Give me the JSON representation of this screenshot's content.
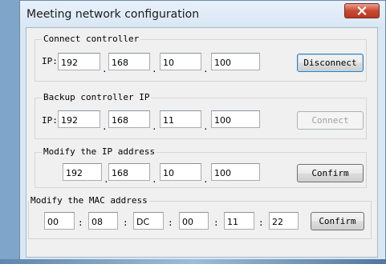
{
  "window": {
    "title": "Meeting network configuration",
    "close_icon": "close-icon"
  },
  "connect": {
    "legend": "Connect controller",
    "ip_label": "IP:",
    "ip": [
      "192",
      "168",
      "10",
      "100"
    ],
    "button": "Disconnect"
  },
  "backup": {
    "legend": "Backup controller IP",
    "ip_label": "IP:",
    "ip": [
      "192",
      "168",
      "11",
      "100"
    ],
    "button": "Connect"
  },
  "modify_ip": {
    "legend": "Modify the IP address",
    "ip": [
      "192",
      "168",
      "10",
      "100"
    ],
    "button": "Confirm"
  },
  "modify_mac": {
    "legend": "Modify the MAC address",
    "mac": [
      "00",
      "08",
      "DC",
      "00",
      "11",
      "22"
    ],
    "button": "Confirm"
  },
  "separators": {
    "ip": ".",
    "mac": ":"
  }
}
